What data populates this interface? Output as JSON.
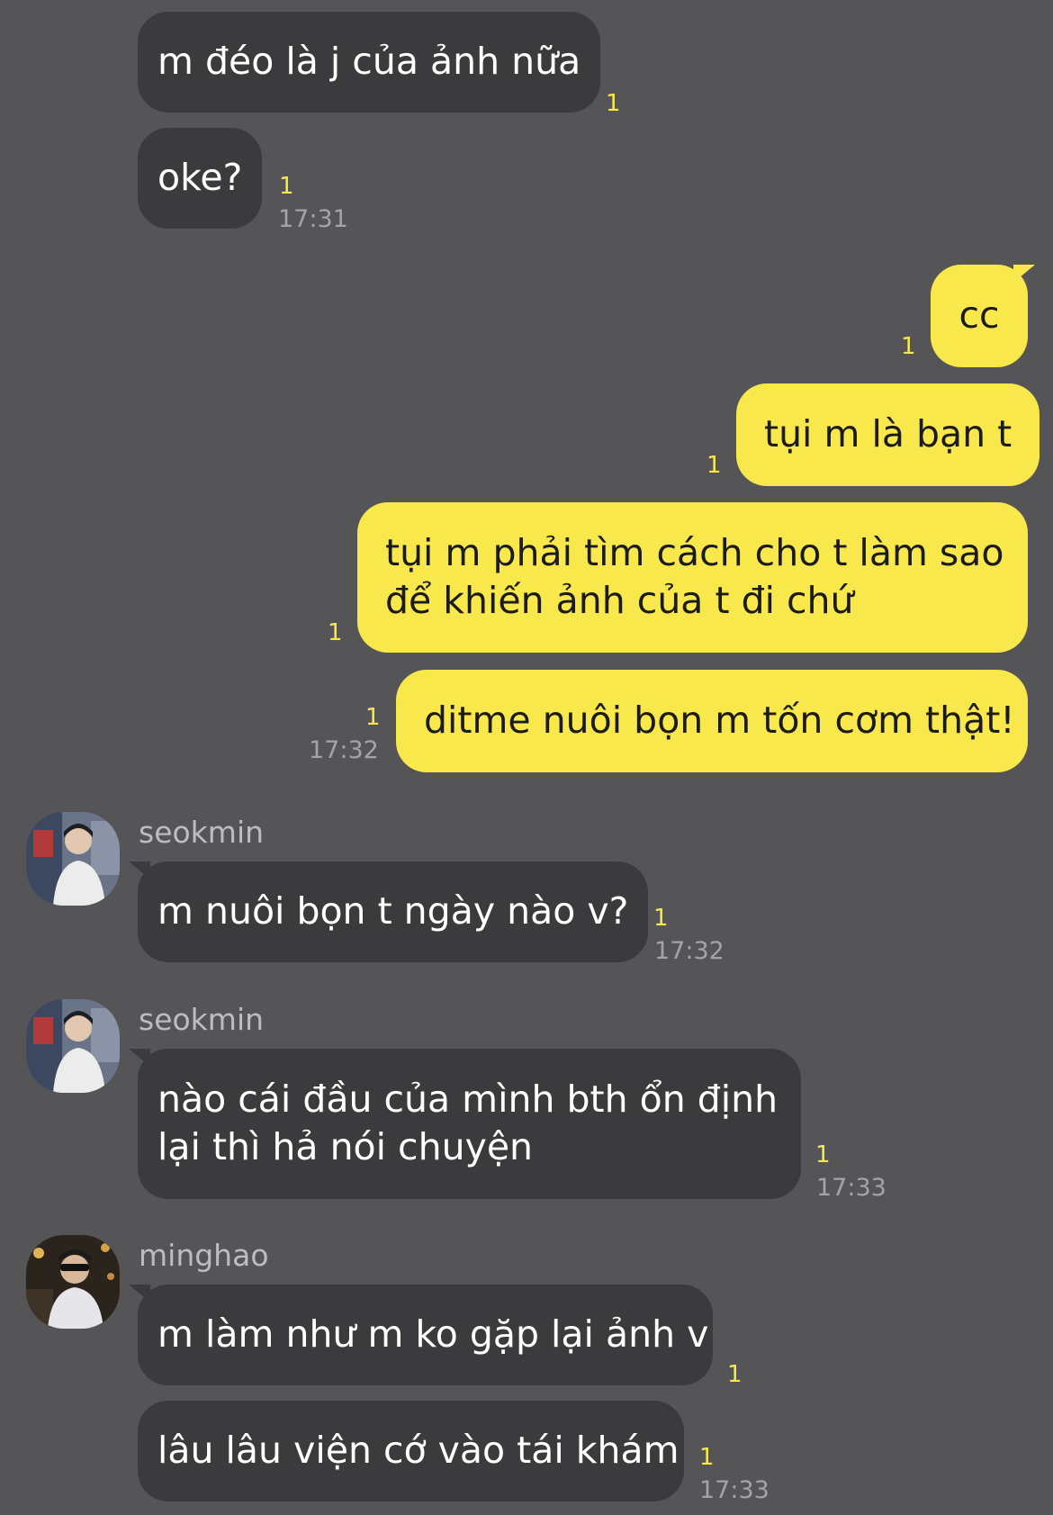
{
  "messages": [
    {
      "text": "m đéo là j của ảnh nữa",
      "read": "1"
    },
    {
      "text": "oke?",
      "read": "1",
      "time": "17:31"
    },
    {
      "text": "cc",
      "read": "1"
    },
    {
      "text": "tụi m là bạn t",
      "read": "1"
    },
    {
      "text": "tụi m phải tìm cách cho t làm sao",
      "text2": "để khiến ảnh của t đi chứ",
      "read": "1"
    },
    {
      "text": "ditme nuôi bọn m tốn cơm thật!",
      "read": "1",
      "time": "17:32"
    },
    {
      "sender": "seokmin",
      "text": "m nuôi bọn t ngày nào v?",
      "read": "1",
      "time": "17:32"
    },
    {
      "sender": "seokmin",
      "text": "nào cái đầu của mình bth ổn định",
      "text2": "lại thì hả nói chuyện",
      "read": "1",
      "time": "17:33"
    },
    {
      "sender": "minghao",
      "text": "m làm như m ko gặp lại ảnh v",
      "read": "1"
    },
    {
      "text": "lâu lâu viện cớ vào tái khám",
      "read": "1",
      "time": "17:33"
    }
  ],
  "colors": {
    "background": "#555456",
    "incoming_bubble": "#3b3a3c",
    "outgoing_bubble": "#f8e84b",
    "read_count": "#f8e84b"
  }
}
